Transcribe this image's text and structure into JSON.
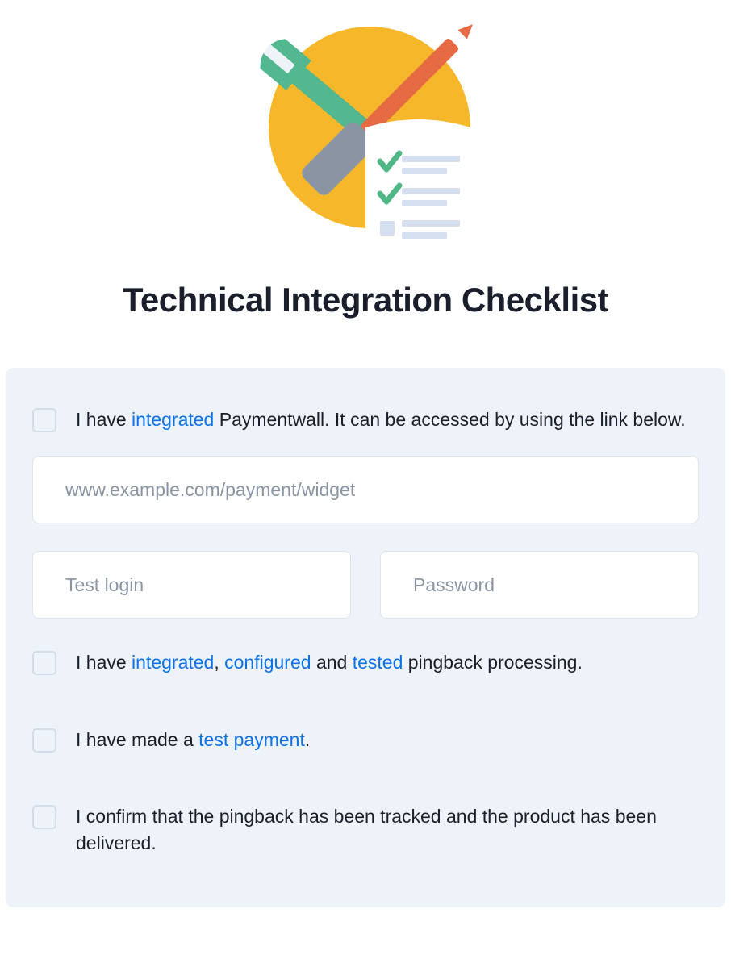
{
  "title": "Technical Integration Checklist",
  "checklist": {
    "item0": {
      "pre": "I have ",
      "link": "integrated",
      "post": " Paymentwall. It can be accessed by using the link below."
    },
    "item1": {
      "pre": "I have ",
      "link1": "integrated",
      "mid1": ", ",
      "link2": "configured",
      "mid2": " and ",
      "link3": "tested",
      "post": " pingback processing."
    },
    "item2": {
      "pre": "I have made a ",
      "link": "test payment",
      "post": "."
    },
    "item3": {
      "text": "I confirm that the pingback has been tracked and the product has been delivered."
    }
  },
  "inputs": {
    "widget_url": {
      "placeholder": "www.example.com/payment/widget"
    },
    "test_login": {
      "placeholder": "Test login"
    },
    "password": {
      "placeholder": "Password"
    }
  }
}
